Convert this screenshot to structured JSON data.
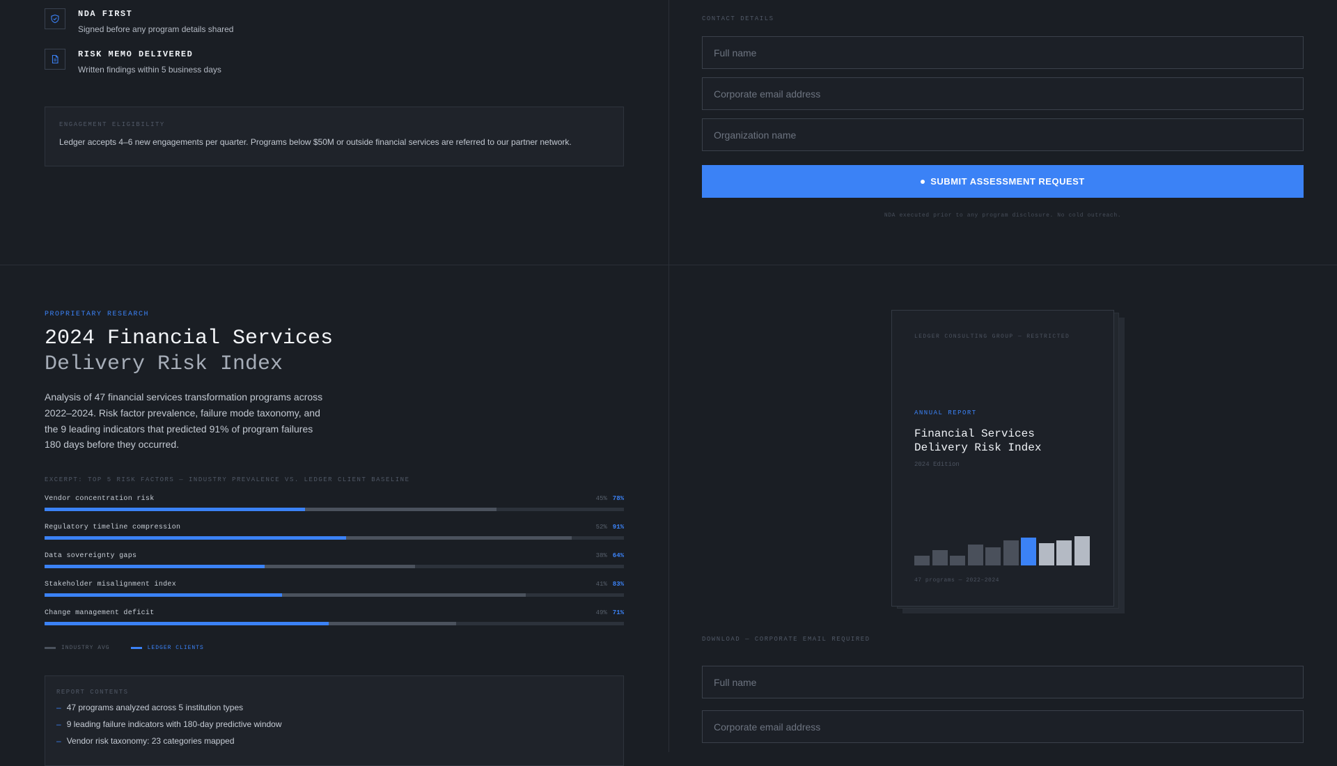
{
  "features": [
    {
      "title": "NDA FIRST",
      "subtitle": "Signed before any program details shared",
      "icon": "shield-icon"
    },
    {
      "title": "RISK MEMO DELIVERED",
      "subtitle": "Written findings within 5 business days",
      "icon": "document-icon"
    }
  ],
  "eligibility": {
    "label": "ENGAGEMENT ELIGIBILITY",
    "text": "Ledger accepts 4–6 new engagements per quarter. Programs below $50M or outside financial services are referred to our partner network."
  },
  "contact_form": {
    "label": "CONTACT DETAILS",
    "full_name_placeholder": "Full name",
    "email_placeholder": "Corporate email address",
    "org_placeholder": "Organization name",
    "submit_label": "SUBMIT ASSESSMENT REQUEST",
    "fineprint": "NDA executed prior to any program disclosure. No cold outreach."
  },
  "research": {
    "eyebrow": "PROPRIETARY RESEARCH",
    "title_line1": "2024 Financial Services",
    "title_line2": "Delivery Risk Index",
    "description": "Analysis of 47 financial services transformation programs across 2022–2024. Risk factor prevalence, failure mode taxonomy, and the 9 leading indicators that predicted 91% of program failures 180 days before they occurred.",
    "excerpt_label": "EXCERPT: TOP 5 RISK FACTORS — INDUSTRY PREVALENCE VS. LEDGER CLIENT BASELINE",
    "legend_industry": "INDUSTRY AVG",
    "legend_ledger": "LEDGER CLIENTS",
    "contents_label": "REPORT CONTENTS",
    "contents": [
      "47 programs analyzed across 5 institution types",
      "9 leading failure indicators with 180-day predictive window",
      "Vendor risk taxonomy: 23 categories mapped"
    ]
  },
  "chart_data": {
    "type": "bar",
    "orientation": "horizontal",
    "categories": [
      "Vendor concentration risk",
      "Regulatory timeline compression",
      "Data sovereignty gaps",
      "Stakeholder misalignment index",
      "Change management deficit"
    ],
    "series": [
      {
        "name": "INDUSTRY AVG",
        "values": [
          78,
          91,
          64,
          83,
          71
        ]
      },
      {
        "name": "LEDGER CLIENTS",
        "values": [
          45,
          52,
          38,
          41,
          49
        ]
      }
    ],
    "value_labels": [
      {
        "industry": "45%",
        "ledger": "78%"
      },
      {
        "industry": "52%",
        "ledger": "91%"
      },
      {
        "industry": "38%",
        "ledger": "64%"
      },
      {
        "industry": "41%",
        "ledger": "83%"
      },
      {
        "industry": "49%",
        "ledger": "71%"
      }
    ],
    "xlim": [
      0,
      100
    ],
    "colors": {
      "industry": "#4b525d",
      "ledger": "#3b82f6",
      "track": "#2c323b"
    }
  },
  "report_cover": {
    "org": "LEDGER CONSULTING GROUP — RESTRICTED",
    "eyebrow": "ANNUAL REPORT",
    "title_line1": "Financial Services",
    "title_line2": "Delivery Risk Index",
    "edition": "2024 Edition",
    "footer": "47 programs — 2022–2024",
    "mini_bars": [
      {
        "value": 14,
        "color": "#4a505b"
      },
      {
        "value": 22,
        "color": "#4a505b"
      },
      {
        "value": 14,
        "color": "#4a505b"
      },
      {
        "value": 30,
        "color": "#4a505b"
      },
      {
        "value": 26,
        "color": "#4a505b"
      },
      {
        "value": 36,
        "color": "#4a505b"
      },
      {
        "value": 40,
        "color": "#3b82f6"
      },
      {
        "value": 32,
        "color": "#b4bac4"
      },
      {
        "value": 36,
        "color": "#b4bac4"
      },
      {
        "value": 42,
        "color": "#b4bac4"
      }
    ]
  },
  "download_form": {
    "label": "DOWNLOAD — CORPORATE EMAIL REQUIRED",
    "full_name_placeholder": "Full name",
    "email_placeholder": "Corporate email address"
  }
}
